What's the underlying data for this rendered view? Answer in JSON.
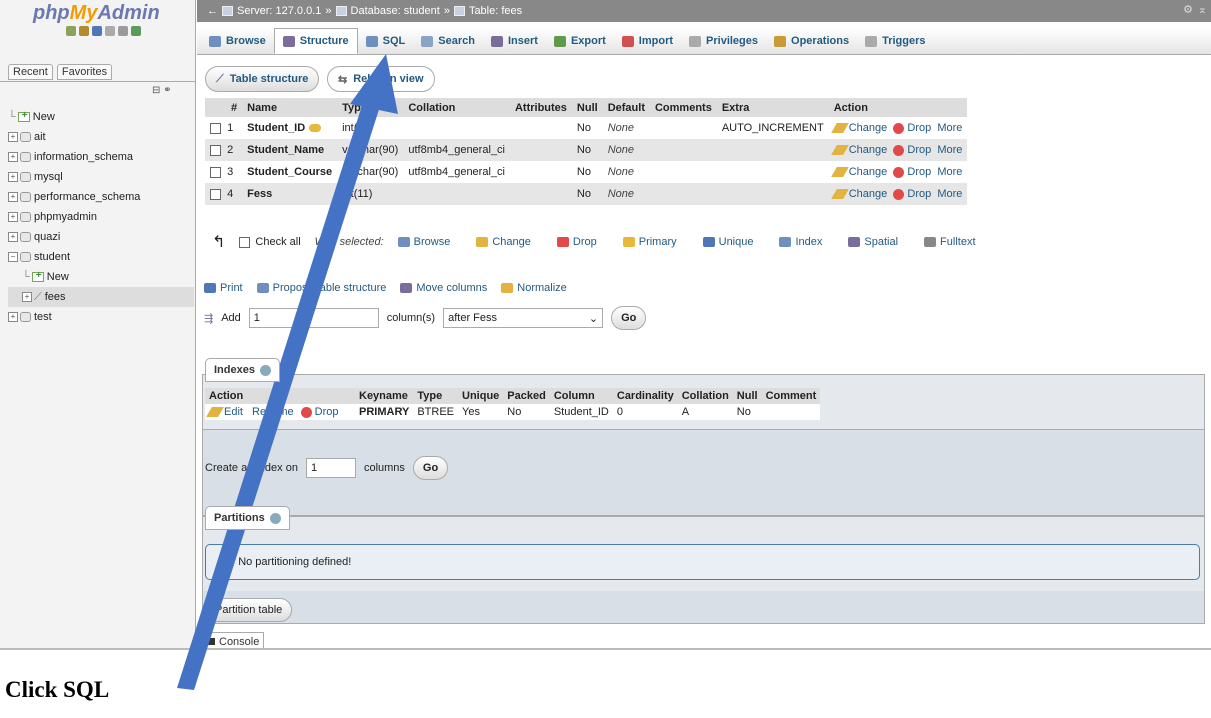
{
  "sidebar": {
    "logo_php": "php",
    "logo_my": "My",
    "logo_admin": "Admin",
    "tab_recent": "Recent",
    "tab_favorites": "Favorites",
    "tree": [
      {
        "label": "New",
        "kind": "new"
      },
      {
        "label": "ait",
        "kind": "db"
      },
      {
        "label": "information_schema",
        "kind": "db"
      },
      {
        "label": "mysql",
        "kind": "db"
      },
      {
        "label": "performance_schema",
        "kind": "db"
      },
      {
        "label": "phpmyadmin",
        "kind": "db"
      },
      {
        "label": "quazi",
        "kind": "db"
      },
      {
        "label": "student",
        "kind": "db-open"
      },
      {
        "label": "New",
        "kind": "new-child"
      },
      {
        "label": "fees",
        "kind": "table-child"
      },
      {
        "label": "test",
        "kind": "db"
      }
    ]
  },
  "breadcrumb": {
    "server": "Server: 127.0.0.1",
    "sep": "»",
    "database": "Database: student",
    "table": "Table: fees"
  },
  "tabs": [
    {
      "label": "Browse",
      "color": "#6f8fbf"
    },
    {
      "label": "Structure",
      "color": "#7a6d9b"
    },
    {
      "label": "SQL",
      "color": "#6f8fbf"
    },
    {
      "label": "Search",
      "color": "#8aa4c8"
    },
    {
      "label": "Insert",
      "color": "#7a6d9b"
    },
    {
      "label": "Export",
      "color": "#5f9a4a"
    },
    {
      "label": "Import",
      "color": "#d05050"
    },
    {
      "label": "Privileges",
      "color": "#aaa"
    },
    {
      "label": "Operations",
      "color": "#c79a3a"
    },
    {
      "label": "Triggers",
      "color": "#aaa"
    }
  ],
  "subtabs": {
    "table_structure": "Table structure",
    "relation_view": "Relation view"
  },
  "structure": {
    "headers": [
      "#",
      "Name",
      "Type",
      "Collation",
      "Attributes",
      "Null",
      "Default",
      "Comments",
      "Extra",
      "Action"
    ],
    "rows": [
      {
        "num": "1",
        "name": "Student_ID",
        "type": "int(11)",
        "collation": "",
        "null": "No",
        "default": "None",
        "extra": "AUTO_INCREMENT",
        "primary": true
      },
      {
        "num": "2",
        "name": "Student_Name",
        "type": "varchar(90)",
        "collation": "utf8mb4_general_ci",
        "null": "No",
        "default": "None",
        "extra": "",
        "primary": false
      },
      {
        "num": "3",
        "name": "Student_Course",
        "type": "varchar(90)",
        "collation": "utf8mb4_general_ci",
        "null": "No",
        "default": "None",
        "extra": "",
        "primary": false
      },
      {
        "num": "4",
        "name": "Fess",
        "type": "int(11)",
        "collation": "",
        "null": "No",
        "default": "None",
        "extra": "",
        "primary": false
      }
    ],
    "change": "Change",
    "drop": "Drop",
    "more": "More"
  },
  "with_selected": {
    "check_all": "Check all",
    "label": "With selected:",
    "buttons": [
      {
        "label": "Browse",
        "color": "#6f8fbf"
      },
      {
        "label": "Change",
        "color": "#e3b341"
      },
      {
        "label": "Drop",
        "color": "#e24a4a"
      },
      {
        "label": "Primary",
        "color": "#e8b83a"
      },
      {
        "label": "Unique",
        "color": "#4f77b8"
      },
      {
        "label": "Index",
        "color": "#6f8fbf"
      },
      {
        "label": "Spatial",
        "color": "#7a6d9b"
      },
      {
        "label": "Fulltext",
        "color": "#888"
      }
    ]
  },
  "table_actions": [
    "Print",
    "Propose table structure",
    "Move columns",
    "Normalize"
  ],
  "add_columns": {
    "label": "Add",
    "value": "1",
    "unit": "column(s)",
    "position": "after Fess",
    "go": "Go"
  },
  "indexes": {
    "title": "Indexes",
    "headers": [
      "Action",
      "Keyname",
      "Type",
      "Unique",
      "Packed",
      "Column",
      "Cardinality",
      "Collation",
      "Null",
      "Comment"
    ],
    "row": {
      "edit": "Edit",
      "rename": "Rename",
      "drop": "Drop",
      "keyname": "PRIMARY",
      "type": "BTREE",
      "unique": "Yes",
      "packed": "No",
      "column": "Student_ID",
      "cardinality": "0",
      "collation": "A",
      "null": "No",
      "comment": ""
    },
    "create_label": "Create an index on",
    "create_value": "1",
    "create_unit": "columns",
    "go": "Go"
  },
  "partitions": {
    "title": "Partitions",
    "message": "No partitioning defined!",
    "button": "Partition table"
  },
  "console": {
    "label": "Console"
  },
  "caption": "Click SQL",
  "colors": {
    "accent": "#235a81",
    "arrow": "#4472c4"
  }
}
